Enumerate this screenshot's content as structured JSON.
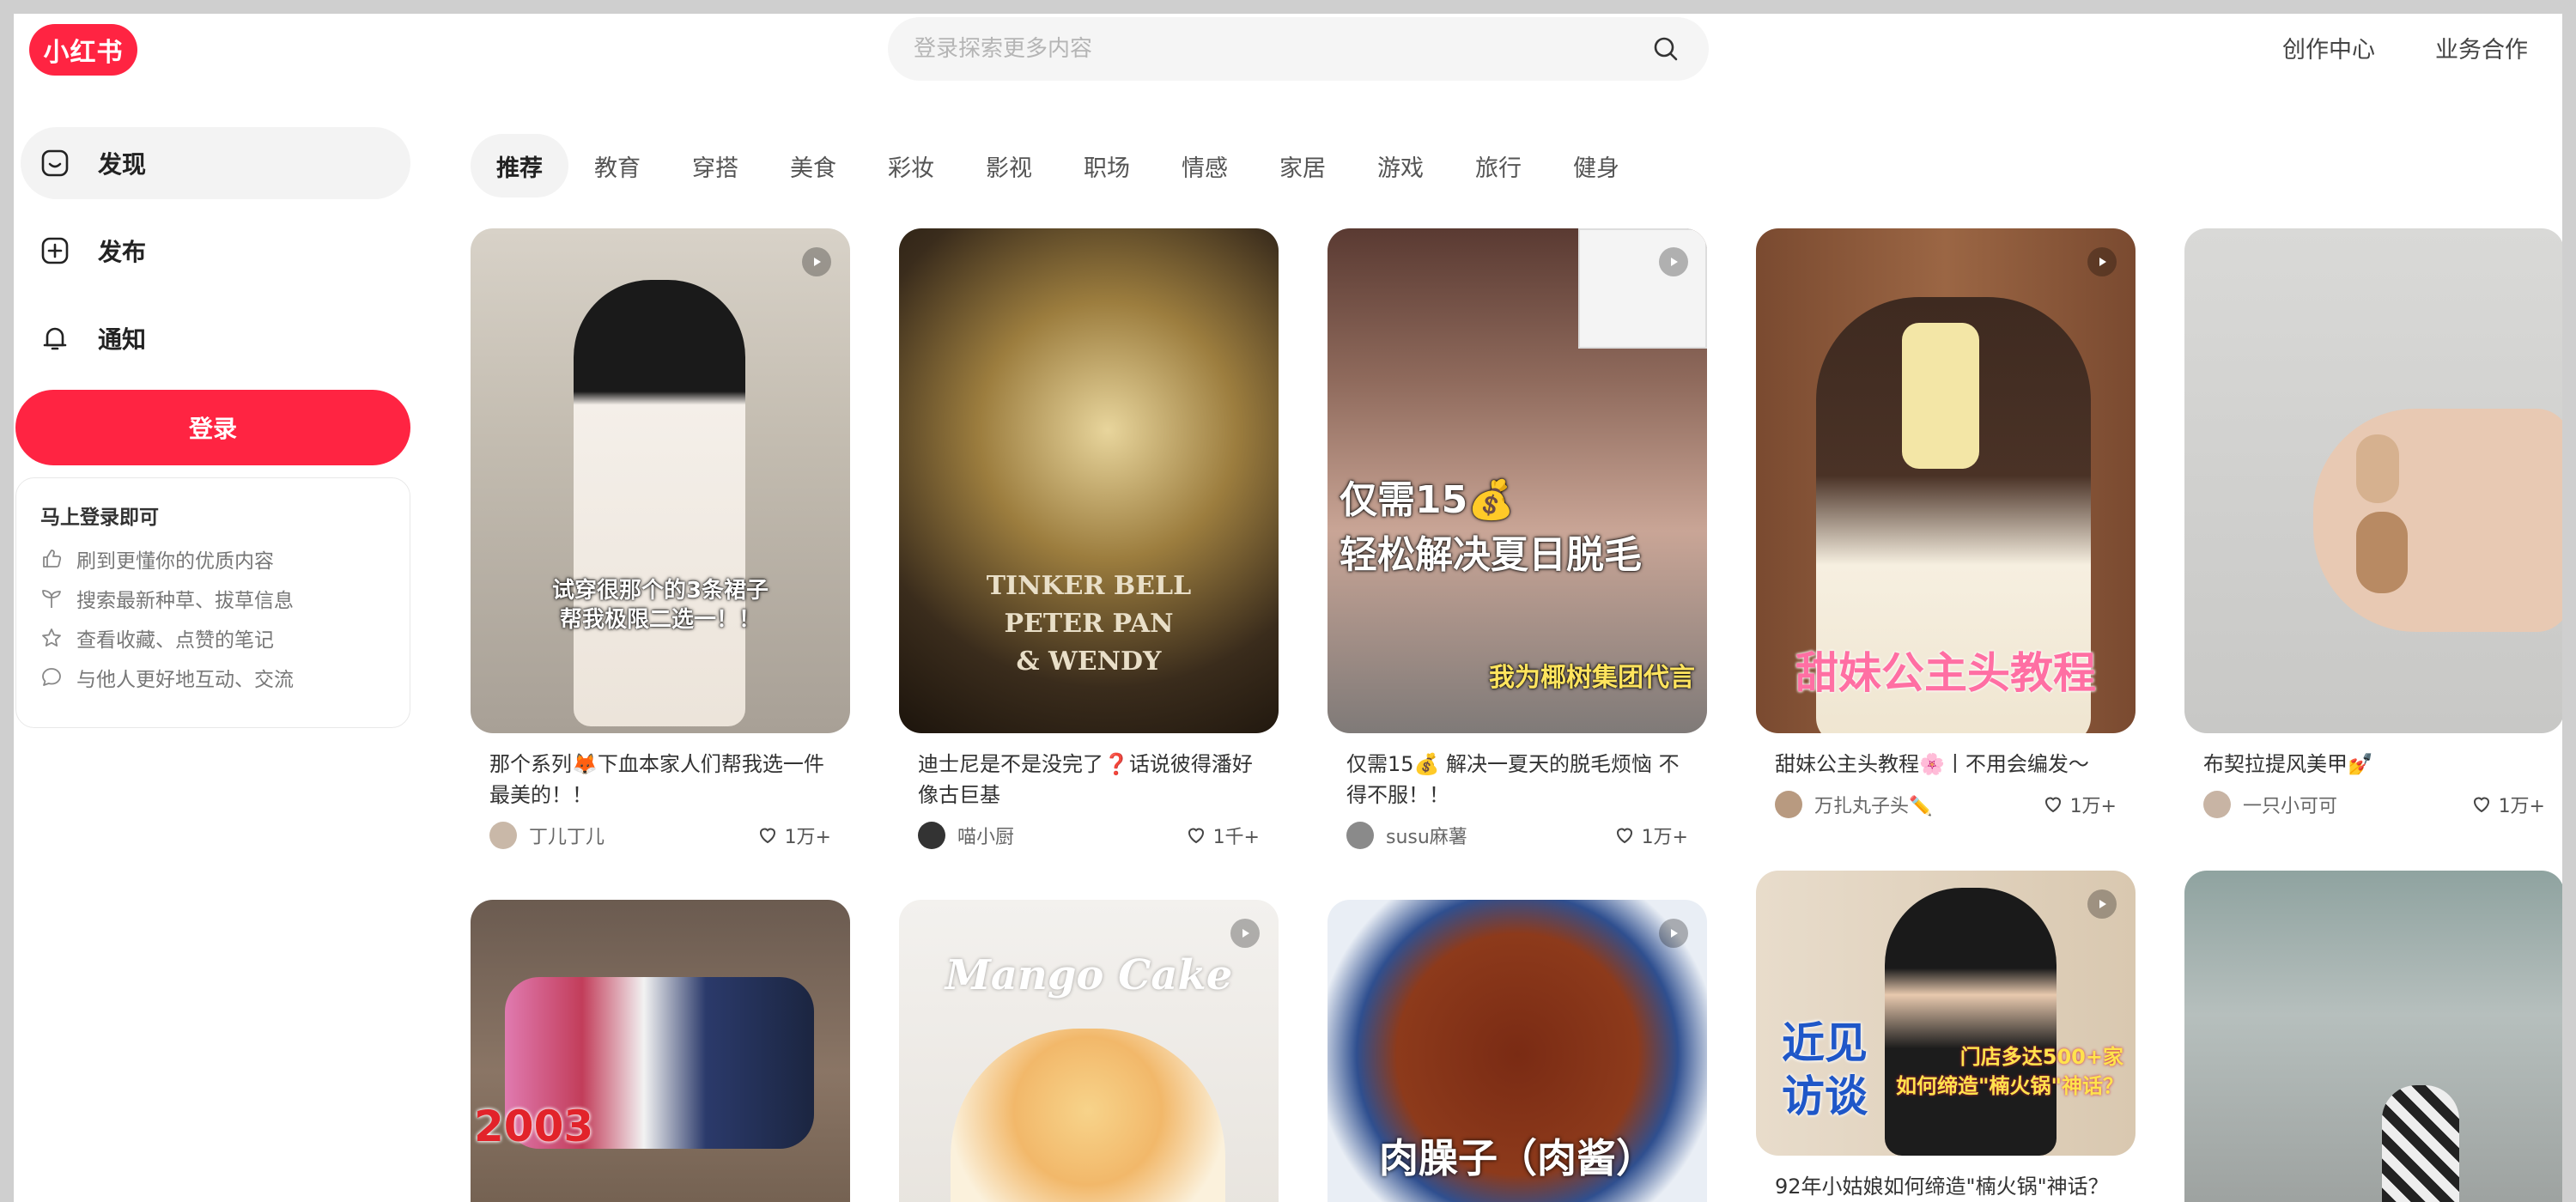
{
  "brand": {
    "logo_text": "小红书",
    "accent": "#ff2442"
  },
  "search": {
    "placeholder": "登录探索更多内容"
  },
  "top_links": [
    "创作中心",
    "业务合作"
  ],
  "sidebar": {
    "items": [
      {
        "label": "发现",
        "icon": "discover-icon",
        "active": true
      },
      {
        "label": "发布",
        "icon": "plus-square-icon",
        "active": false
      },
      {
        "label": "通知",
        "icon": "bell-icon",
        "active": false
      }
    ],
    "login_label": "登录",
    "tips": {
      "title": "马上登录即可",
      "rows": [
        {
          "icon": "thumb-up-icon",
          "text": "刷到更懂你的优质内容"
        },
        {
          "icon": "sprout-icon",
          "text": "搜索最新种草、拔草信息"
        },
        {
          "icon": "star-icon",
          "text": "查看收藏、点赞的笔记"
        },
        {
          "icon": "chat-bubble-icon",
          "text": "与他人更好地互动、交流"
        }
      ]
    }
  },
  "channels": [
    "推荐",
    "教育",
    "穿搭",
    "美食",
    "彩妆",
    "影视",
    "职场",
    "情感",
    "家居",
    "游戏",
    "旅行",
    "健身"
  ],
  "cards": [
    {
      "title": "那个系列🦊下血本家人们帮我选一件最美的！！",
      "author": "丁儿丁儿",
      "likes": "1万+",
      "overlay": "试穿很那个的3条裙子\n帮我极限二选一！！",
      "video": true
    },
    {
      "title": "迪士尼是不是没完了❓话说彼得潘好像古巨基",
      "author": "喵小厨",
      "likes": "1千+",
      "overlay": "TINKER BELL\nPETER PAN\n& WENDY",
      "video": false
    },
    {
      "title": "仅需15💰 解决一夏天的脱毛烦恼 不得不服！！",
      "author": "susu麻薯",
      "likes": "1万+",
      "overlay": "仅需15💰\n轻松解决夏日脱毛",
      "overlay2": "我为椰树集团代言",
      "video": true
    },
    {
      "title": "甜妹公主头教程🌸丨不用会编发～",
      "author": "万扎丸子头✏️",
      "likes": "1万+",
      "overlay": "甜妹公主头教程",
      "video": true
    },
    {
      "title": "布契拉提风美甲💅",
      "author": "一只小可可",
      "likes": "1万+",
      "video": false
    },
    {
      "title": "",
      "author": "",
      "likes": "",
      "overlay": "2003",
      "video": false
    },
    {
      "title": "",
      "author": "",
      "likes": "",
      "overlay": "Mango Cake",
      "video": true
    },
    {
      "title": "",
      "author": "",
      "likes": "",
      "overlay": "肉臊子（肉酱）",
      "video": true
    },
    {
      "title": "92年小姑娘如何缔造\"楠火锅\"神话？",
      "author": "",
      "likes": "",
      "overlay": "近见\n访谈",
      "overlay2": "门店多达500+家\n如何缔造\"楠火锅\"神话？",
      "video": true
    },
    {
      "title": "",
      "author": "",
      "likes": "",
      "video": false
    }
  ]
}
